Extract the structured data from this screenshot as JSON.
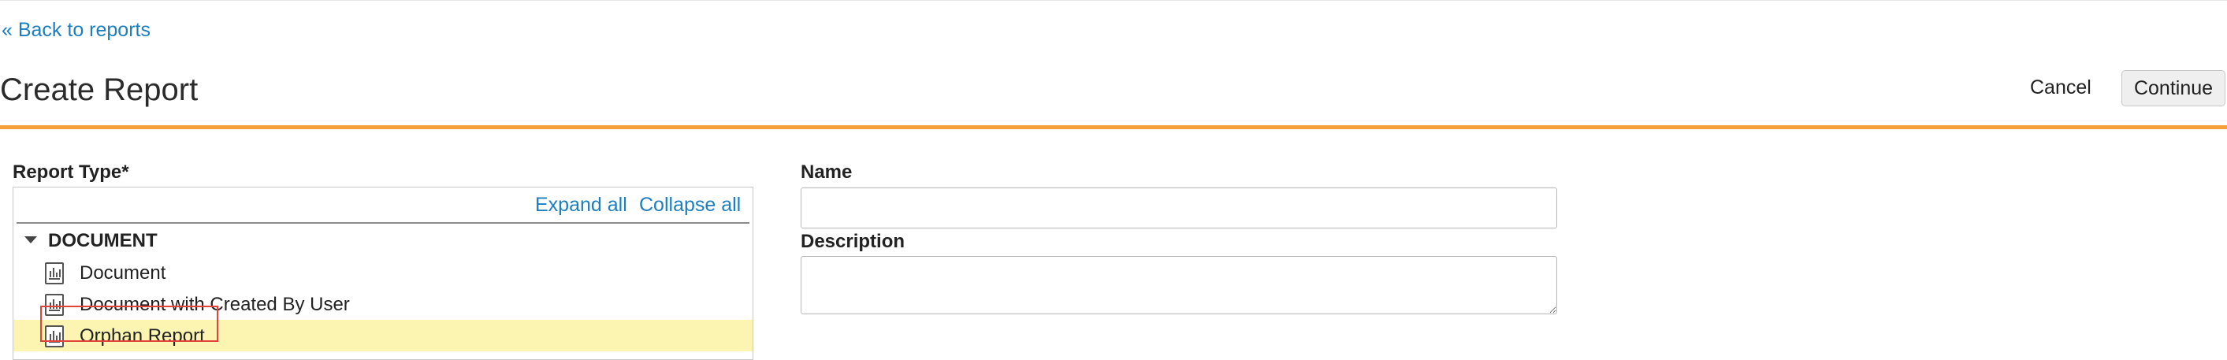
{
  "nav": {
    "back_label": "« Back to reports"
  },
  "header": {
    "title": "Create Report",
    "cancel_label": "Cancel",
    "continue_label": "Continue"
  },
  "report_type": {
    "label": "Report Type*",
    "expand_all": "Expand all",
    "collapse_all": "Collapse all",
    "group": {
      "name": "DOCUMENT",
      "expanded": true,
      "items": [
        {
          "label": "Document",
          "icon": "report-icon",
          "selected": false
        },
        {
          "label": "Document with Created By User",
          "icon": "report-icon",
          "selected": false
        },
        {
          "label": "Orphan Report",
          "icon": "report-icon",
          "selected": true
        }
      ]
    }
  },
  "form": {
    "name_label": "Name",
    "name_value": "",
    "description_label": "Description",
    "description_value": ""
  },
  "colors": {
    "accent": "#f5a03a",
    "link": "#1b7fc0",
    "selected_row": "#fcf4b1",
    "highlight_outline": "#e2433a"
  }
}
